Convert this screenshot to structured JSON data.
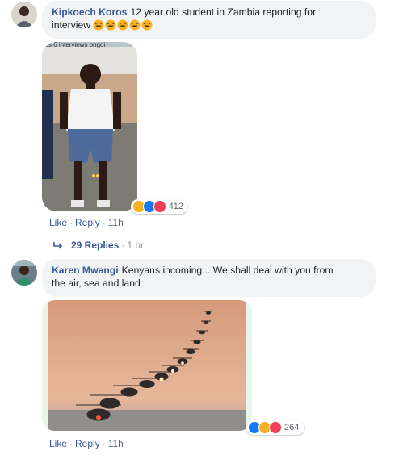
{
  "comments": [
    {
      "author": "Kipkoech Koros",
      "text_line1": "12 year old student in Zambia reporting for",
      "text_line2": "interview",
      "emoji_icon": "laughing-emoji-icon",
      "emoji_count": 5,
      "photo_caption": "ss 6 interviews ongoi",
      "reaction_icons": [
        "haha-reaction-icon",
        "like-reaction-icon",
        "love-reaction-icon"
      ],
      "reaction_count": "412",
      "like_label": "Like",
      "reply_label": "Reply",
      "time": "11h",
      "replies_label": "29 Replies",
      "replies_time": "1 hr"
    },
    {
      "author": "Karen Mwangi",
      "text_line1": "Kenyans incoming... We shall deal with you from",
      "text_line2": "the air, sea and land",
      "reaction_icons": [
        "like-reaction-icon",
        "haha-reaction-icon",
        "love-reaction-icon"
      ],
      "reaction_count": "264",
      "like_label": "Like",
      "reply_label": "Reply",
      "time": "11h"
    }
  ],
  "colors": {
    "author": "#385898",
    "bubble": "#f2f3f5",
    "like": "#1877f2",
    "haha": "#f7b125",
    "love": "#f33e58"
  }
}
